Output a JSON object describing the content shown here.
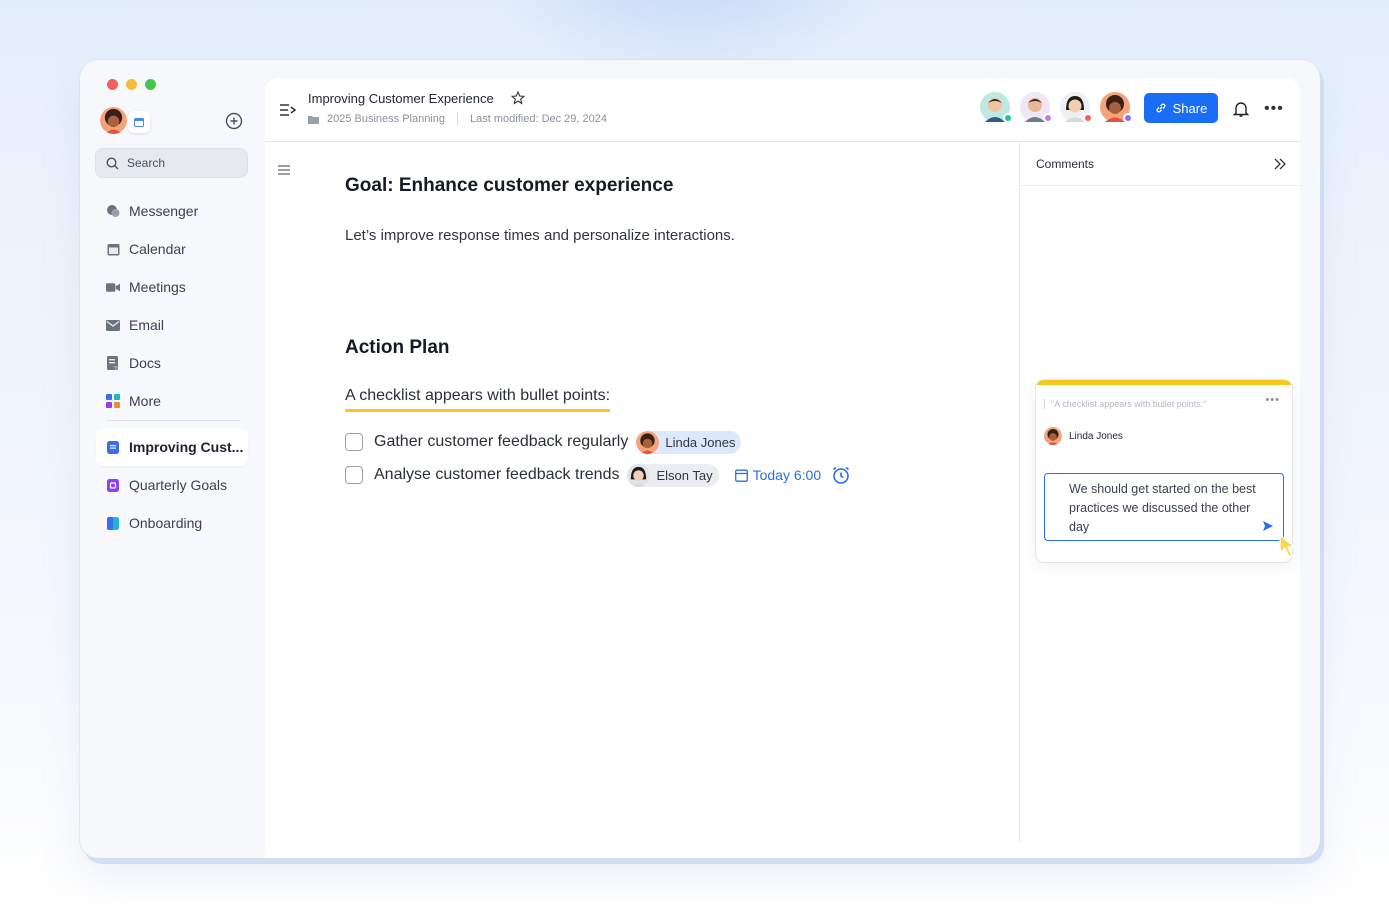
{
  "sidebar": {
    "search_label": "Search",
    "nav_items": [
      {
        "label": "Messenger",
        "icon": "messenger-icon"
      },
      {
        "label": "Calendar",
        "icon": "calendar-icon"
      },
      {
        "label": "Meetings",
        "icon": "video-icon"
      },
      {
        "label": "Email",
        "icon": "mail-icon"
      },
      {
        "label": "Docs",
        "icon": "docs-icon"
      },
      {
        "label": "More",
        "icon": "apps-icon"
      }
    ],
    "docs": [
      {
        "label": "Improving Cust...",
        "active": true,
        "color": "#3b6df0"
      },
      {
        "label": "Quarterly Goals",
        "active": false,
        "color": "#8a3ff0"
      },
      {
        "label": "Onboarding",
        "active": false,
        "color": "#1fb6c9"
      }
    ]
  },
  "header": {
    "title": "Improving Customer Experience",
    "folder": "2025 Business Planning",
    "last_modified": "Last modified: Dec 29, 2024",
    "share_label": "Share",
    "collaborator_status_colors": [
      "#1ec6a0",
      "#c77ae6",
      "#f2605a",
      "#9b6af5"
    ]
  },
  "document": {
    "goal_heading": "Goal: Enhance customer experience",
    "goal_text": "Let’s improve response times and personalize interactions.",
    "plan_heading": "Action Plan",
    "checklist_intro": "A checklist appears with bullet points:",
    "tasks": [
      {
        "text": "Gather customer feedback regularly",
        "assignee": "Linda Jones",
        "checked": false
      },
      {
        "text": "Analyse customer feedback trends",
        "assignee": "Elson Tay",
        "due": "Today 6:00",
        "checked": false
      }
    ]
  },
  "comments": {
    "title": "Comments",
    "quote": "\"A checklist appears with bullet points:\"",
    "author": "Linda Jones",
    "draft": "We should get started on the best practices we discussed the other day"
  },
  "colors": {
    "accent": "#1a6ef5",
    "highlight": "#f9c51f"
  }
}
